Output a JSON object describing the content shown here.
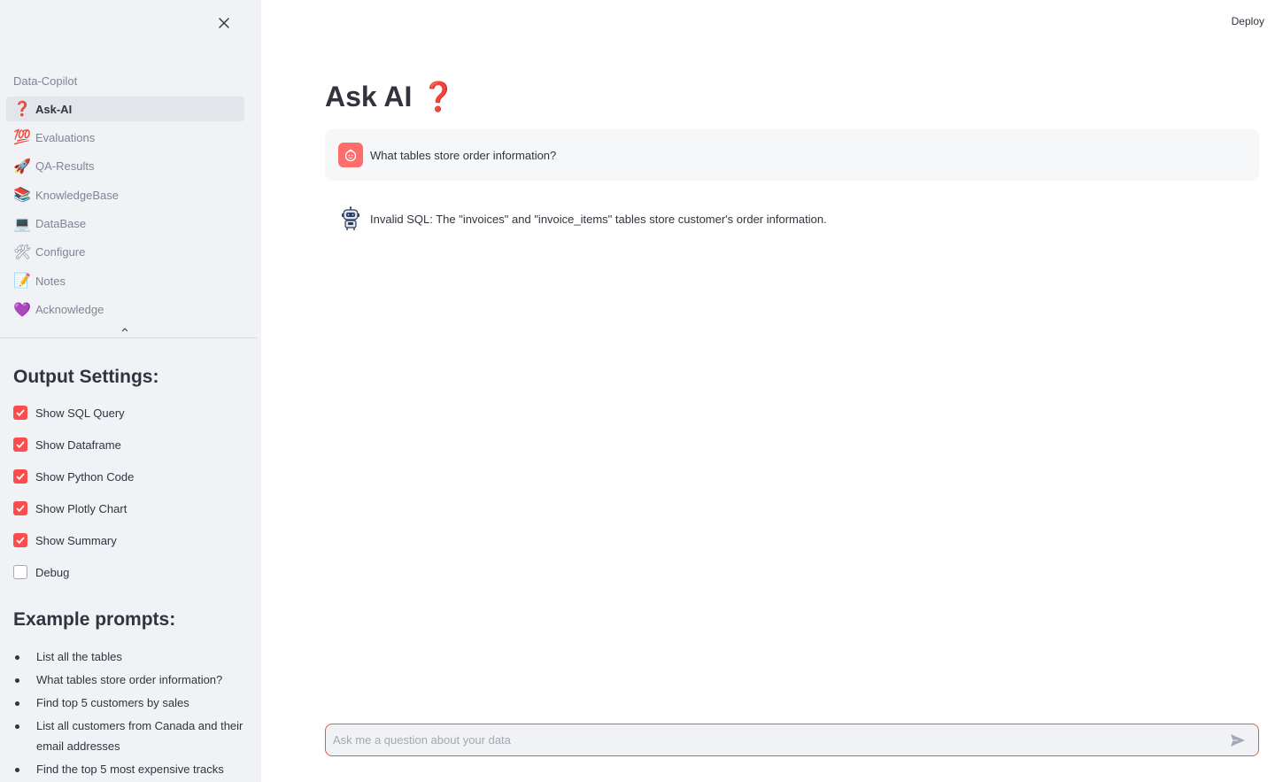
{
  "header": {
    "deploy_label": "Deploy"
  },
  "sidebar": {
    "nav_header": "Data-Copilot",
    "items": [
      {
        "icon": "question-mark-icon",
        "glyph": "❓",
        "label": "Ask-AI",
        "active": true
      },
      {
        "icon": "hundred-points-icon",
        "glyph": "💯",
        "label": "Evaluations"
      },
      {
        "icon": "rocket-icon",
        "glyph": "🚀",
        "label": "QA-Results"
      },
      {
        "icon": "books-icon",
        "glyph": "📚",
        "label": "KnowledgeBase"
      },
      {
        "icon": "laptop-icon",
        "glyph": "💻",
        "label": "DataBase"
      },
      {
        "icon": "tools-icon",
        "glyph": "🛠",
        "label": "Configure"
      },
      {
        "icon": "memo-icon",
        "glyph": "📝",
        "label": "Notes"
      },
      {
        "icon": "purple-heart-icon",
        "glyph": "💜",
        "label": "Acknowledge"
      }
    ],
    "output_settings": {
      "title": "Output Settings:",
      "options": [
        {
          "label": "Show SQL Query",
          "checked": true
        },
        {
          "label": "Show Dataframe",
          "checked": true
        },
        {
          "label": "Show Python Code",
          "checked": true
        },
        {
          "label": "Show Plotly Chart",
          "checked": true
        },
        {
          "label": "Show Summary",
          "checked": true
        },
        {
          "label": "Debug",
          "checked": false
        }
      ]
    },
    "examples": {
      "title": "Example prompts:",
      "items": [
        "List all the tables",
        "What tables store order information?",
        "Find top 5 customers by sales",
        "List all customers from Canada and their email addresses",
        "Find the top 5 most expensive tracks"
      ]
    }
  },
  "main": {
    "title": "Ask AI",
    "title_emoji": "❓",
    "messages": [
      {
        "role": "user",
        "text": "What tables store order information?"
      },
      {
        "role": "assistant",
        "text": "Invalid SQL: The \"invoices\" and \"invoice_items\" tables store customer's order information."
      }
    ],
    "chat_input": {
      "placeholder": "Ask me a question about your data",
      "value": ""
    }
  },
  "colors": {
    "accent": "#ff4b4b",
    "sidebar_bg": "#f0f2f6",
    "text": "#31333f",
    "muted": "#808495"
  }
}
